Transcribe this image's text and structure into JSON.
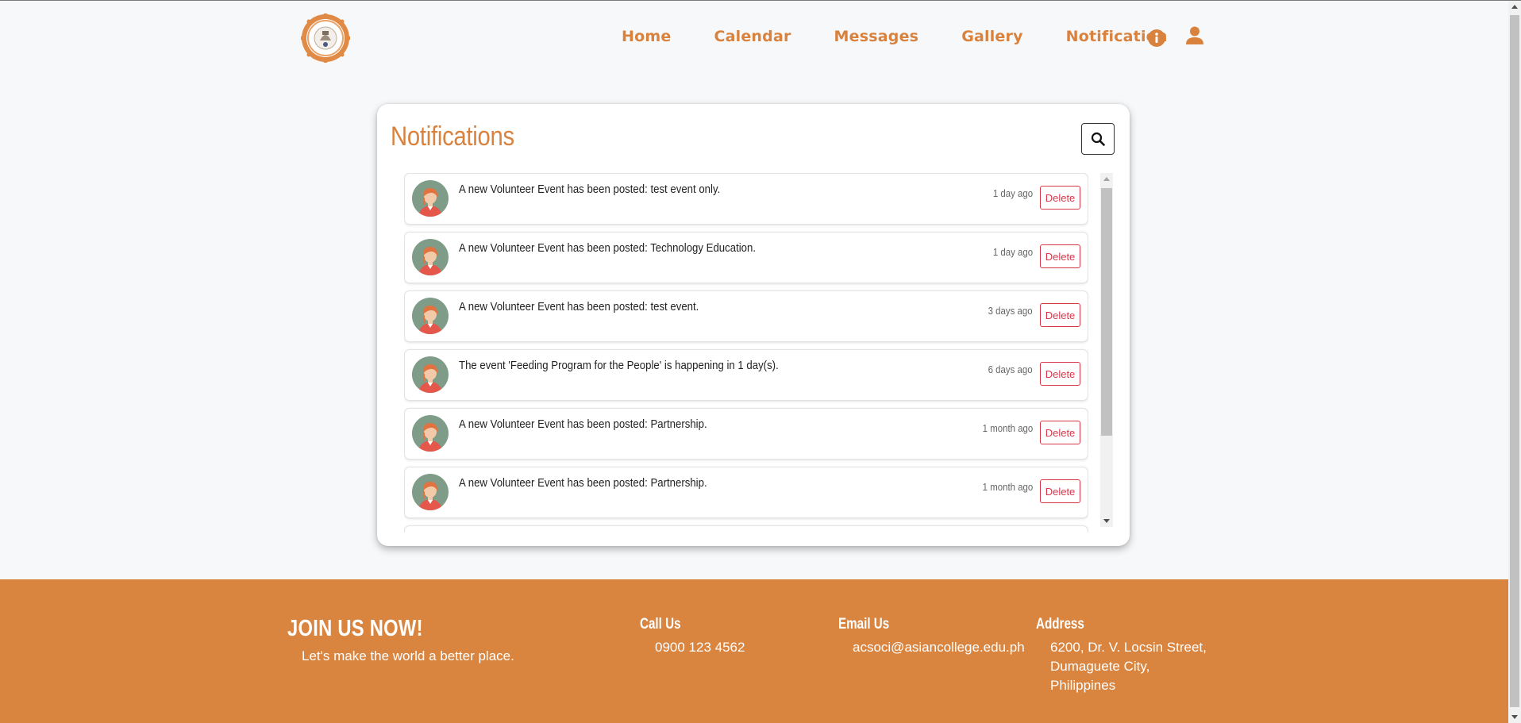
{
  "nav": {
    "items": [
      {
        "label": "Home"
      },
      {
        "label": "Calendar"
      },
      {
        "label": "Messages"
      },
      {
        "label": "Gallery"
      },
      {
        "label": "Notification"
      }
    ],
    "icons": [
      "info-icon",
      "user-icon"
    ]
  },
  "colors": {
    "accent": "#d9823e",
    "footer_bg": "#d9843f",
    "delete_red": "#d9364a",
    "avatar_bg": "#7e9c87"
  },
  "notifications": {
    "title": "Notifications",
    "search_icon": "search-icon",
    "items": [
      {
        "message": "A new Volunteer Event has been posted: test event only.",
        "time": "1 day ago",
        "delete_label": "Delete"
      },
      {
        "message": "A new Volunteer Event has been posted: Technology Education.",
        "time": "1 day ago",
        "delete_label": "Delete"
      },
      {
        "message": "A new Volunteer Event has been posted: test event.",
        "time": "3 days ago",
        "delete_label": "Delete"
      },
      {
        "message": "The event 'Feeding Program for the People' is happening in 1 day(s).",
        "time": "6 days ago",
        "delete_label": "Delete"
      },
      {
        "message": "A new Volunteer Event has been posted: Partnership.",
        "time": "1 month ago",
        "delete_label": "Delete"
      },
      {
        "message": "A new Volunteer Event has been posted: Partnership.",
        "time": "1 month ago",
        "delete_label": "Delete"
      }
    ]
  },
  "footer": {
    "join_title": "JOIN US NOW!",
    "tagline": "Let's make the world a better place.",
    "call": {
      "title": "Call Us",
      "value": "0900 123 4562"
    },
    "email": {
      "title": "Email Us",
      "value": "acsoci@asiancollege.edu.ph"
    },
    "address": {
      "title": "Address",
      "lines": [
        "6200, Dr. V. Locsin Street,",
        "Dumaguete City,",
        "Philippines"
      ]
    }
  }
}
